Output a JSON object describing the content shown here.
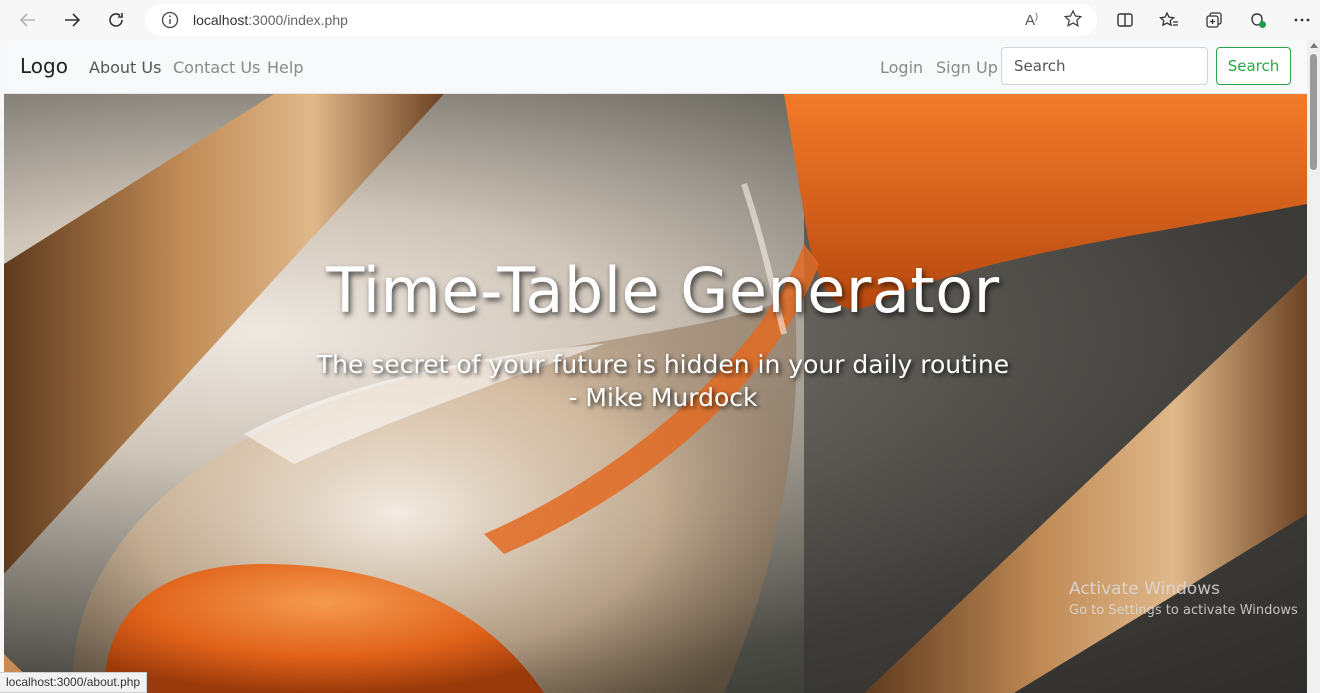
{
  "browser": {
    "url_host": "localhost",
    "url_rest": ":3000/index.php",
    "status_url": "localhost:3000/about.php"
  },
  "navbar": {
    "brand": "Logo",
    "left_links": [
      {
        "label": "About Us"
      },
      {
        "label": "Contact Us"
      },
      {
        "label": "Help"
      }
    ],
    "right_links": [
      {
        "label": "Login"
      },
      {
        "label": "Sign Up"
      }
    ],
    "search_placeholder": "Search",
    "search_button": "Search",
    "search_button_color": "#28a745"
  },
  "hero": {
    "title": "Time-Table Generator",
    "quote_line1": "The secret of your future is hidden in your daily routine",
    "quote_line2": "- Mike Murdock"
  },
  "watermark": {
    "line1": "Activate Windows",
    "line2": "Go to Settings to activate Windows"
  },
  "icons": [
    "back-icon",
    "forward-icon",
    "refresh-icon",
    "info-icon",
    "read-aloud-icon",
    "favorite-star-icon",
    "split-screen-icon",
    "favorites-icon",
    "collections-icon",
    "extension-icon",
    "more-icon"
  ]
}
